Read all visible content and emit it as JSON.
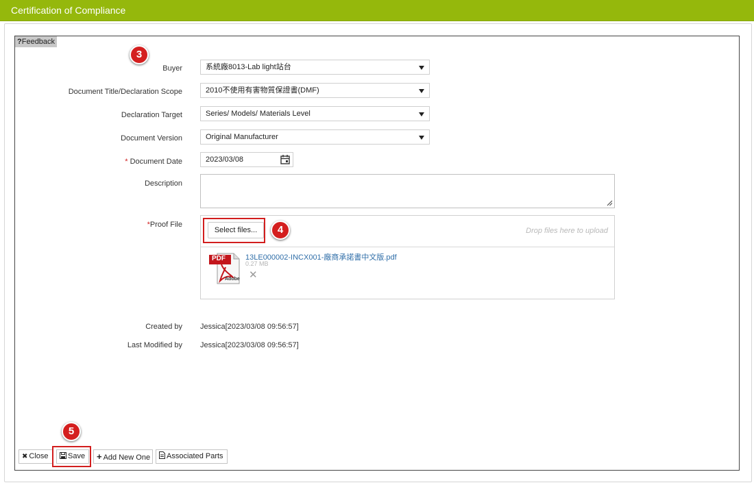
{
  "window": {
    "title": "Certification of Compliance"
  },
  "feedback": {
    "label": "Feedback",
    "icon": "?"
  },
  "form": {
    "buyer": {
      "label": "Buyer",
      "value": "系統廠8013-Lab light站台"
    },
    "scope": {
      "label": "Document Title/Declaration Scope",
      "value": "2010不使用有害物質保證書(DMF)"
    },
    "target": {
      "label": "Declaration Target",
      "value": "Series/ Models/ Materials Level"
    },
    "version": {
      "label": "Document Version",
      "value": "Original Manufacturer"
    },
    "date": {
      "required_mark": "*",
      "label": "Document Date",
      "value": "2023/03/08"
    },
    "description": {
      "label": "Description",
      "value": ""
    },
    "proof": {
      "required_mark": "*",
      "label": "Proof File",
      "select_label": "Select files...",
      "drop_hint": "Drop files here to upload",
      "file_name": "13LE000002-INCX001-廠商承諾書中文版.pdf",
      "file_size": "0.27 MB",
      "pdf_badge": "PDF",
      "pdf_brand": "Adobe",
      "remove_icon": "✕"
    }
  },
  "meta": {
    "created_label": "Created by",
    "created_value": "Jessica[2023/03/08 09:56:57]",
    "modified_label": "Last Modified by",
    "modified_value": "Jessica[2023/03/08 09:56:57]"
  },
  "toolbar": {
    "close": "Close",
    "save": "Save",
    "add_new": "Add New One",
    "associated": "Associated Parts"
  },
  "badges": {
    "b3": "3",
    "b4": "4",
    "b5": "5"
  },
  "colors": {
    "title_bar": "#95b80c",
    "annotation_red": "#d21d1d",
    "link": "#2f6ea8"
  }
}
